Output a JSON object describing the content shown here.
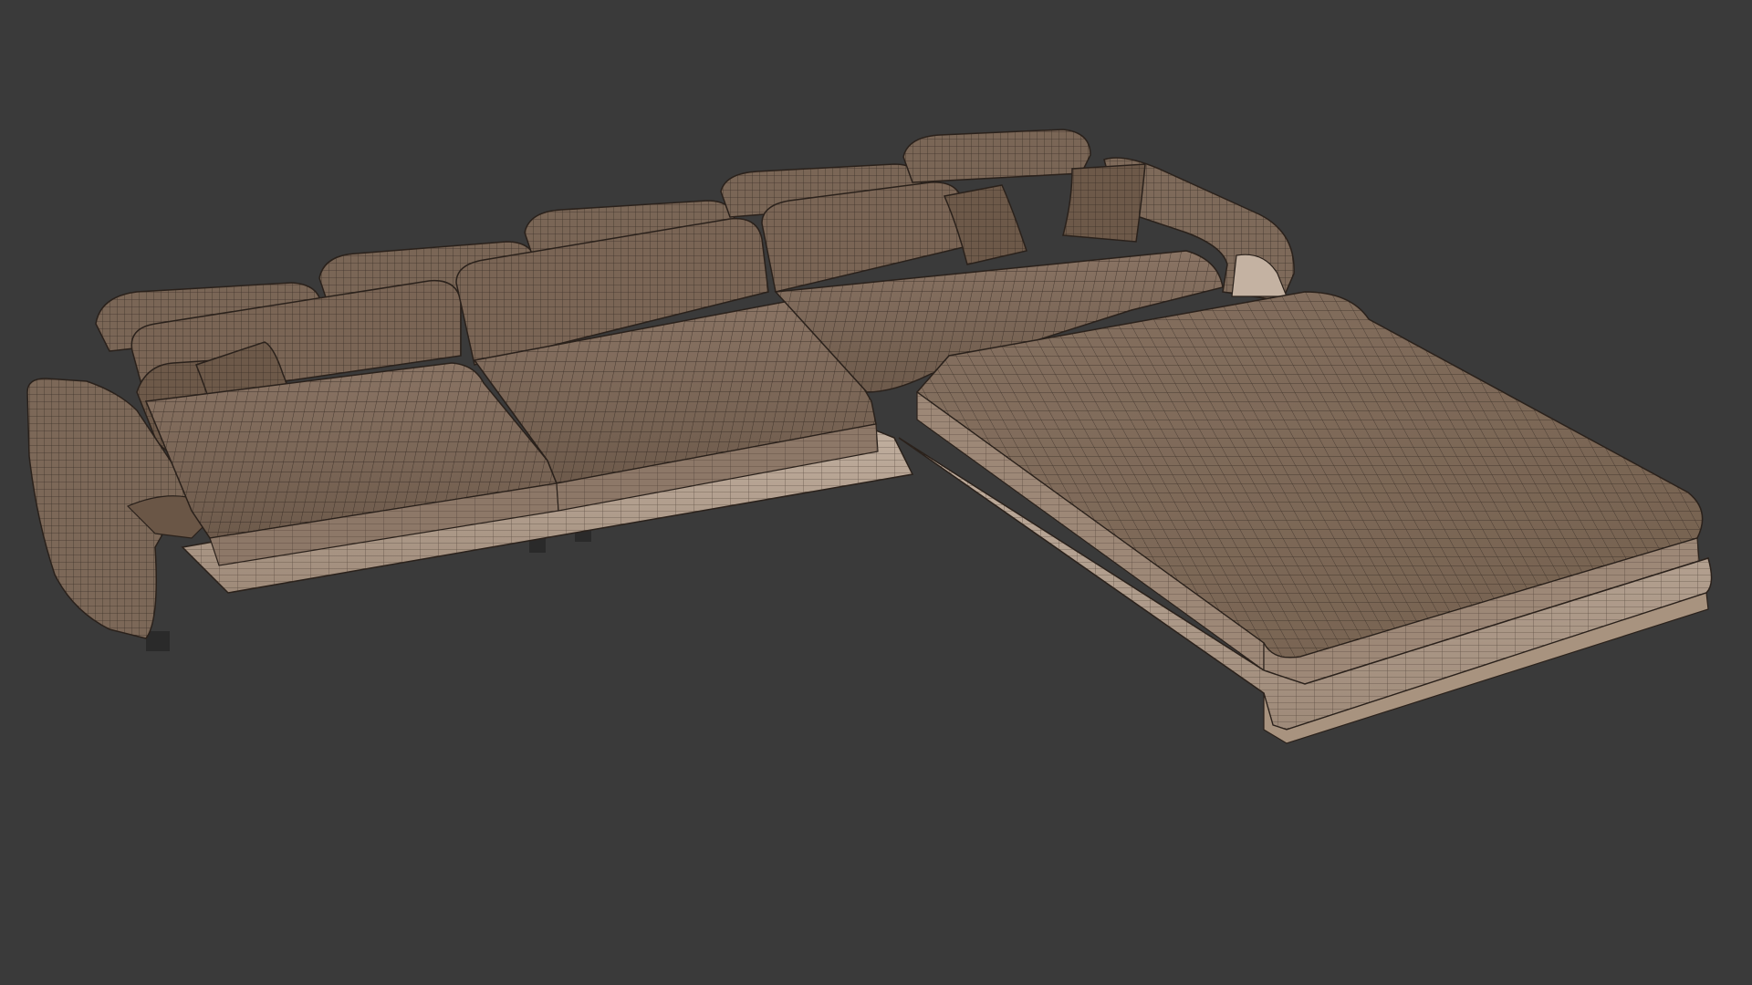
{
  "viewport": {
    "background": "#3a3a3a"
  },
  "model": {
    "render_style": "wireframe-over-shaded",
    "fabric_color": "#7d6858",
    "fabric_light": "#8c7666",
    "fabric_dark": "#5e4d40",
    "base_color": "#b8a595",
    "base_dark": "#9a8574",
    "wire_color": "#2a211b",
    "foot_color": "#2a2a2a"
  }
}
